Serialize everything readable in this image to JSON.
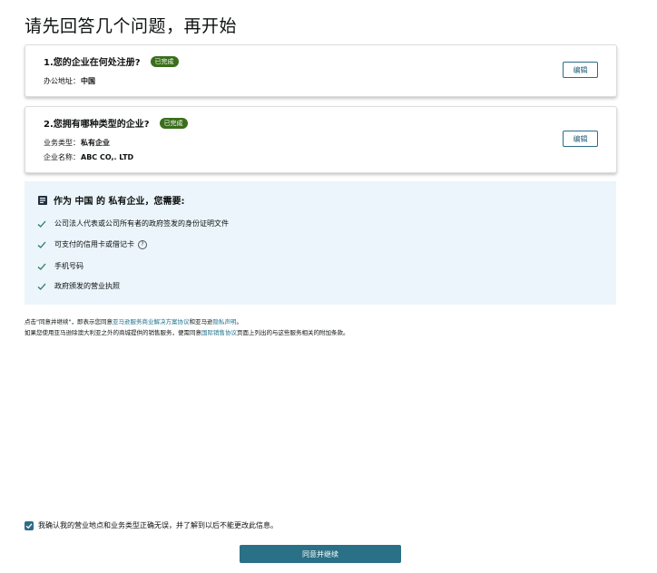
{
  "page": {
    "title": "请先回答几个问题，再开始"
  },
  "q1": {
    "title": "1.您的企业在何处注册?",
    "badge": "已完成",
    "address_label": "办公地址：",
    "address_value": "中国",
    "edit_label": "编辑"
  },
  "q2": {
    "title": "2.您拥有哪种类型的企业?",
    "badge": "已完成",
    "type_label": "业务类型：",
    "type_value": "私有企业",
    "name_label": "企业名称：",
    "name_value": "ABC CO,. LTD",
    "edit_label": "编辑"
  },
  "requirements": {
    "heading": "作为 中国 的 私有企业，您需要:",
    "items": [
      "公司法人代表或公司所有者的政府签发的身份证明文件",
      "可支付的信用卡或借记卡",
      "手机号码",
      "政府颁发的营业执照"
    ],
    "help_glyph": "?"
  },
  "legal": {
    "line1_pre": "点击\"同意并继续\"，即表示您同意",
    "line1_link1": "亚马逊服务商业解决方案协议",
    "line1_mid": "和亚马逊",
    "line1_link2": "隐私声明",
    "line1_post": "。",
    "line2_pre": "如果您使用亚马逊除澳大利亚之外的商城提供的销售服务，便需同意",
    "line2_link": "国际销售协议",
    "line2_post": "页面上列出的与这些服务相关的附加条款。"
  },
  "confirm": {
    "label": "我确认我的营业地点和业务类型正确无误，并了解到以后不能更改此信息。",
    "checked": true
  },
  "continue": {
    "label": "同意并继续"
  },
  "colors": {
    "badge": "#3a6e1b",
    "primary_button": "#2a7086",
    "info_box": "#ebf5fb",
    "check": "#2a7a5f",
    "link": "#1f6f8b"
  }
}
